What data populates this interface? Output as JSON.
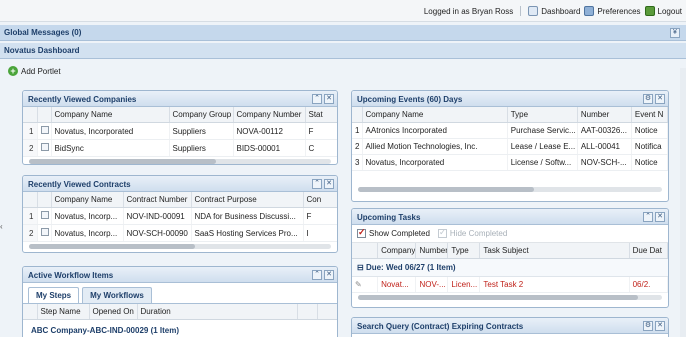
{
  "header": {
    "logged_in": "Logged in as Bryan Ross",
    "dashboard": "Dashboard",
    "preferences": "Preferences",
    "logout": "Logout"
  },
  "global_messages": {
    "title": "Global Messages (0)",
    "collapse_glyph": "¥"
  },
  "dashboard": {
    "title": "Novatus Dashboard"
  },
  "add_portlet": "Add Portlet",
  "recent_companies": {
    "title": "Recently Viewed Companies",
    "columns": [
      "",
      "",
      "Company Name",
      "Company Group",
      "Company Number",
      "Stat"
    ],
    "rows": [
      {
        "num": "1",
        "name": "Novatus, Incorporated",
        "group": "Suppliers",
        "number": "NOVA-00112",
        "stat": "F"
      },
      {
        "num": "2",
        "name": "BidSync",
        "group": "Suppliers",
        "number": "BIDS-00001",
        "stat": "C"
      }
    ]
  },
  "recent_contracts": {
    "title": "Recently Viewed Contracts",
    "columns": [
      "",
      "",
      "Company Name",
      "Contract Number",
      "Contract Purpose",
      "Con"
    ],
    "rows": [
      {
        "num": "1",
        "name": "Novatus, Incorp...",
        "number": "NOV-IND-00091",
        "purpose": "NDA for Business Discussi...",
        "con": "F"
      },
      {
        "num": "2",
        "name": "Novatus, Incorp...",
        "number": "NOV-SCH-00090",
        "purpose": "SaaS Hosting Services Pro...",
        "con": "I"
      }
    ]
  },
  "workflow": {
    "title": "Active Workflow Items",
    "tabs": [
      "My Steps",
      "My Workflows"
    ],
    "columns": [
      "Step Name",
      "Opened On",
      "Duration"
    ],
    "item": "ABC Company-ABC-IND-00029 (1 Item)"
  },
  "upcoming_events": {
    "title": "Upcoming Events (60) Days",
    "columns": [
      "",
      "Company Name",
      "Type",
      "Number",
      "Event N"
    ],
    "rows": [
      {
        "num": "1",
        "name": "AAtronics Incorporated",
        "type": "Purchase Servic...",
        "number": "AAT-00326...",
        "event": "Notice"
      },
      {
        "num": "2",
        "name": "Allied Motion Technologies, Inc.",
        "type": "Lease / Lease E...",
        "number": "ALL-00041",
        "event": "Notifica"
      },
      {
        "num": "3",
        "name": "Novatus, Incorporated",
        "type": "License / Softw...",
        "number": "NOV-SCH-...",
        "event": "Notice"
      }
    ]
  },
  "upcoming_tasks": {
    "title": "Upcoming Tasks",
    "show_completed": "Show Completed",
    "hide_completed": "Hide Completed",
    "columns": [
      "",
      "Company",
      "Number",
      "Type",
      "Task Subject",
      "Due Dat"
    ],
    "group": "Due: Wed 06/27 (1 Item)",
    "row": {
      "company": "Novat...",
      "number": "NOV-...",
      "type": "Licen...",
      "subject": "Test Task 2",
      "due": "06/2."
    }
  },
  "search_query": {
    "title": "Search Query (Contract) Expiring Contracts"
  }
}
